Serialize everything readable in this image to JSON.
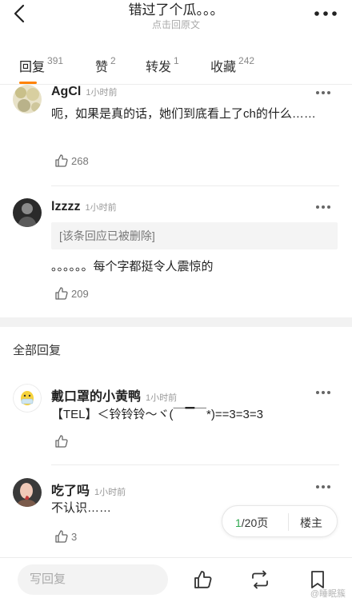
{
  "header": {
    "title": "错过了个瓜。。。",
    "subtitle": "点击回原文"
  },
  "tabs": [
    {
      "label": "回复",
      "count": "391",
      "active": true
    },
    {
      "label": "赞",
      "count": "2"
    },
    {
      "label": "转发",
      "count": "1"
    },
    {
      "label": "收藏",
      "count": "242"
    }
  ],
  "hot_comments": [
    {
      "user": "AgCl",
      "time": "1小时前",
      "text": "呃，如果是真的话，她们到底看上了ch的什么……",
      "likes": "268"
    },
    {
      "user": "lzzzz",
      "time": "1小时前",
      "quote": "[该条回应已被删除]",
      "text": "。。。。。。每个字都挺令人震惊的",
      "likes": "209"
    }
  ],
  "all_replies": {
    "section_title": "全部回复",
    "items": [
      {
        "user": "戴口罩的小黄鸭",
        "time": "1小时前",
        "text": "【TEL】＜铃铃铃～ヾ(￣▔￣*)==3=3=3",
        "likes": ""
      },
      {
        "user": "吃了吗",
        "time": "1小时前",
        "text": "不认识……",
        "likes": "3"
      }
    ]
  },
  "pager": {
    "current": "1",
    "total_text": "/20页",
    "louzhu_label": "楼主"
  },
  "bottom": {
    "reply_placeholder": "写回复",
    "watermark": "@睡眠簇"
  },
  "colors": {
    "accent": "#ff8200",
    "page_current": "#2fa84f"
  }
}
